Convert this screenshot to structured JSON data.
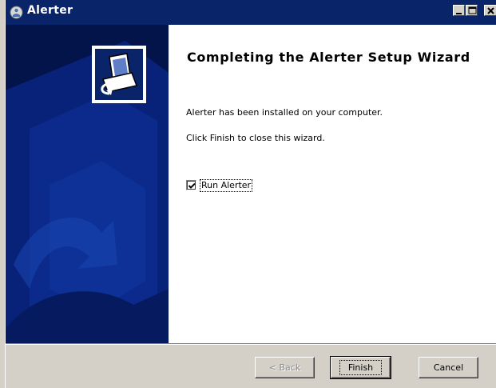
{
  "window": {
    "title": "Alerter",
    "controls": [
      "minimize",
      "maximize",
      "close"
    ]
  },
  "wizard": {
    "heading": "Completing the Alerter Setup Wizard",
    "message1": "Alerter has been installed on your computer.",
    "message2": "Click Finish to close this wizard.",
    "run_checkbox": {
      "label": "Run Alerter",
      "checked": true
    }
  },
  "buttons": {
    "back": "< Back",
    "finish": "Finish",
    "cancel": "Cancel"
  },
  "colors": {
    "titlebar": "#0a246a",
    "sidepanel": "#02144a",
    "sidepanel_shape": "#0d2f8c"
  },
  "icons": [
    "app-icon",
    "installer-icon"
  ]
}
